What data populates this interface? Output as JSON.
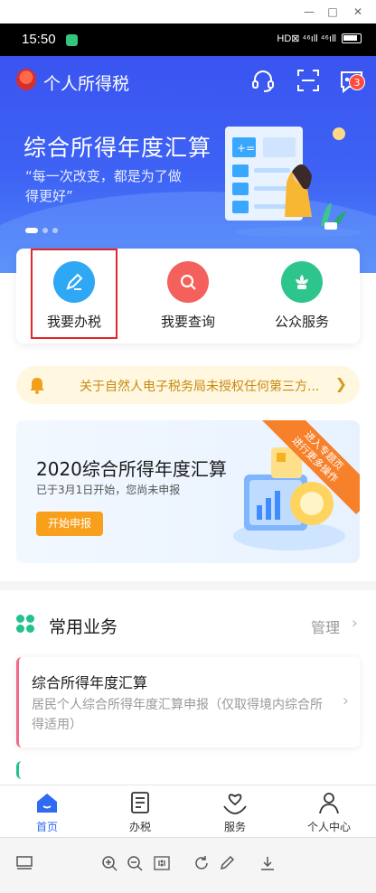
{
  "window": {
    "controls": [
      "—",
      "□",
      "✕"
    ]
  },
  "status_bar": {
    "time": "15:50",
    "indicators": "HD⊠ ⁴⁶ıll ⁴⁶ıll"
  },
  "header": {
    "app_title": "个人所得税",
    "message_badge": "3",
    "icons": [
      "headset-icon",
      "scan-icon",
      "message-icon"
    ]
  },
  "banner": {
    "title": "综合所得年度汇算",
    "subtitle": "“每一次改变，都是为了做得更好”",
    "dots": 3,
    "active_dot": 0
  },
  "services": [
    {
      "label": "我要办税",
      "icon": "edit-icon",
      "color": "#2ea8f5",
      "highlighted": true
    },
    {
      "label": "我要查询",
      "icon": "search-icon",
      "color": "#f4615c"
    },
    {
      "label": "公众服务",
      "icon": "flower-icon",
      "color": "#2ec58d"
    }
  ],
  "notice": {
    "text": "关于自然人电子税务局未授权任何第三方..."
  },
  "annual_card": {
    "title": "2020综合所得年度汇算",
    "subtitle": "已于3月1日开始，您尚未申报",
    "button": "开始申报",
    "ribbon": "进入专题页\n进行更多操作"
  },
  "common_business": {
    "title": "常用业务",
    "manage": "管理",
    "items": [
      {
        "title": "综合所得年度汇算",
        "desc": "居民个人综合所得年度汇算申报（仅取得境内综合所得适用）"
      }
    ]
  },
  "bottom_nav": [
    {
      "label": "首页",
      "icon": "home-icon",
      "active": true
    },
    {
      "label": "办税",
      "icon": "document-icon"
    },
    {
      "label": "服务",
      "icon": "heart-hand-icon"
    },
    {
      "label": "个人中心",
      "icon": "person-icon"
    }
  ],
  "viewer_toolbar": [
    "layout-icon",
    "zoom-in-icon",
    "zoom-out-icon",
    "actual-size-icon",
    "rotate-icon",
    "edit-icon",
    "download-icon"
  ],
  "colors": {
    "primary_blue": "#3e63f5",
    "accent_orange": "#f8a01c",
    "highlight_red": "#e2262a"
  }
}
